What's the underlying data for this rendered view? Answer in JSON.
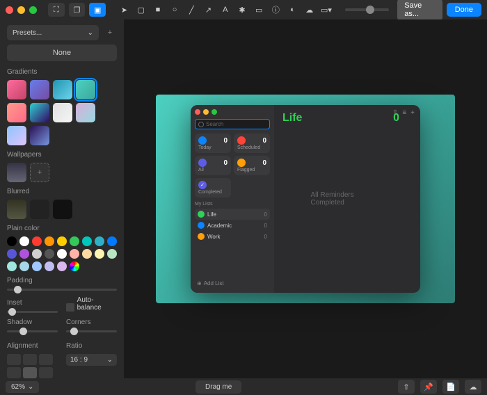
{
  "toolbar": {
    "save_label": "Save as...",
    "done_label": "Done"
  },
  "sidebar": {
    "presets_label": "Presets...",
    "none_label": "None",
    "sections": {
      "gradients": "Gradients",
      "wallpapers": "Wallpapers",
      "blurred": "Blurred",
      "plain": "Plain color",
      "padding": "Padding",
      "inset": "Inset",
      "shadow": "Shadow",
      "corners": "Corners",
      "alignment": "Alignment",
      "ratio": "Ratio"
    },
    "autobalance": "Auto-balance",
    "ratio_value": "16 : 9",
    "gradients": [
      "linear-gradient(135deg,#ff6b9d,#c44569)",
      "linear-gradient(135deg,#667eea,#764ba2)",
      "linear-gradient(135deg,#2193b0,#6dd5ed)",
      "linear-gradient(135deg,#4dd0c0,#3ba89c)",
      "linear-gradient(135deg,#ff9a8b,#ff6a88)",
      "linear-gradient(135deg,#30cfd0,#330867)",
      "linear-gradient(135deg,#e0e0e0,#f5f5f5)",
      "linear-gradient(135deg,#d9afd9,#97d9e1)",
      "linear-gradient(135deg,#8ec5fc,#e0c3fc)",
      "linear-gradient(135deg,#2b1055,#7597de)"
    ],
    "plain_colors": [
      "#000",
      "#fff",
      "#ff3b30",
      "#ff9500",
      "#ffcc00",
      "#34c759",
      "#00c7be",
      "#30b0c7",
      "#007aff",
      "#5856d6",
      "#af52de",
      "#d0d0d0",
      "#555",
      "#fff",
      "#ffb3a7",
      "#ffd9a0",
      "#fff3b0",
      "#b8e6c1",
      "#a0e6e0",
      "#a8d8e8",
      "#a0c8ff",
      "#c0bef0",
      "#d9b8ef",
      "conic-gradient(red,yellow,lime,cyan,blue,magenta,red)"
    ]
  },
  "app": {
    "search_placeholder": "Search",
    "categories": [
      {
        "label": "Today",
        "count": "0",
        "color": "#0a84ff"
      },
      {
        "label": "Scheduled",
        "count": "0",
        "color": "#ff453a"
      },
      {
        "label": "All",
        "count": "0",
        "color": "#5e5ce6"
      },
      {
        "label": "Flagged",
        "count": "0",
        "color": "#ff9f0a"
      }
    ],
    "completed_label": "Completed",
    "my_lists_label": "My Lists",
    "lists": [
      {
        "name": "Life",
        "count": "0",
        "color": "#30d158",
        "selected": true
      },
      {
        "name": "Academic",
        "count": "0",
        "color": "#0a84ff",
        "selected": false
      },
      {
        "name": "Work",
        "count": "0",
        "color": "#ff9f0a",
        "selected": false
      }
    ],
    "add_list_label": "Add List",
    "current_list": "Life",
    "current_count": "0",
    "empty_message": "All Reminders Completed"
  },
  "footer": {
    "zoom": "62%",
    "drag_label": "Drag me"
  }
}
